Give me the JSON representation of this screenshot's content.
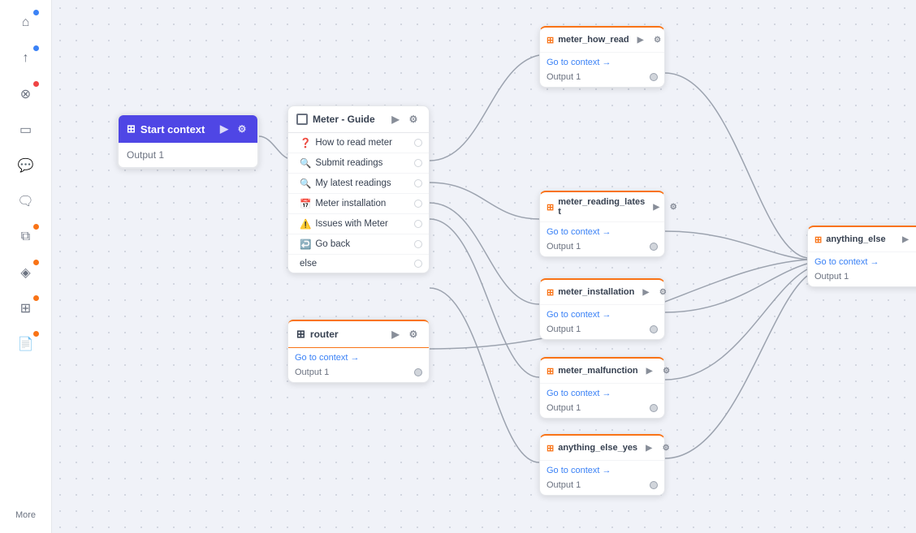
{
  "sidebar": {
    "items": [
      {
        "id": "home",
        "icon": "⌂",
        "dot": "blue"
      },
      {
        "id": "import",
        "icon": "⬆",
        "dot": "blue"
      },
      {
        "id": "error",
        "icon": "⊗",
        "dot": "red"
      },
      {
        "id": "chat",
        "icon": "▭",
        "dot": null
      },
      {
        "id": "message",
        "icon": "💬",
        "dot": null
      },
      {
        "id": "message2",
        "icon": "🗨",
        "dot": null
      },
      {
        "id": "copy",
        "icon": "⧉",
        "dot": "orange"
      },
      {
        "id": "diamond",
        "icon": "◈",
        "dot": "orange"
      },
      {
        "id": "grid",
        "icon": "⊞",
        "dot": "orange"
      },
      {
        "id": "file",
        "icon": "📄",
        "dot": "orange"
      }
    ],
    "more_label": "More"
  },
  "nodes": {
    "start_context": {
      "header": "Start context",
      "output_label": "Output 1"
    },
    "meter_guide": {
      "title": "Meter - Guide",
      "items": [
        {
          "emoji": "❓",
          "text": "How to read meter"
        },
        {
          "emoji": "🔍",
          "text": "Submit readings"
        },
        {
          "emoji": "🔍",
          "text": "My latest readings"
        },
        {
          "emoji": "📅",
          "text": "Meter installation"
        },
        {
          "emoji": "⚠️",
          "text": "Issues with Meter"
        },
        {
          "emoji": "↩️",
          "text": "Go back"
        },
        {
          "text": "else"
        }
      ]
    },
    "router": {
      "title": "router",
      "go_to_context": "Go to context →",
      "output_label": "Output 1"
    },
    "meter_how_read": {
      "title": "meter_how_read",
      "go_to_context": "Go to context →",
      "output_label": "Output 1"
    },
    "meter_reading_latest": {
      "title": "meter_reading_lates t",
      "go_to_context": "Go to context →",
      "output_label": "Output 1"
    },
    "meter_installation": {
      "title": "meter_installation",
      "go_to_context": "Go to context →",
      "output_label": "Output 1"
    },
    "meter_malfunction": {
      "title": "meter_malfunction",
      "go_to_context": "Go to context →",
      "output_label": "Output 1"
    },
    "anything_else_yes": {
      "title": "anything_else_yes",
      "go_to_context": "Go to context →",
      "output_label": "Output 1"
    },
    "anything_else": {
      "title": "anything_else",
      "go_to_context": "Go to context →",
      "output_label": "Output 1"
    }
  }
}
